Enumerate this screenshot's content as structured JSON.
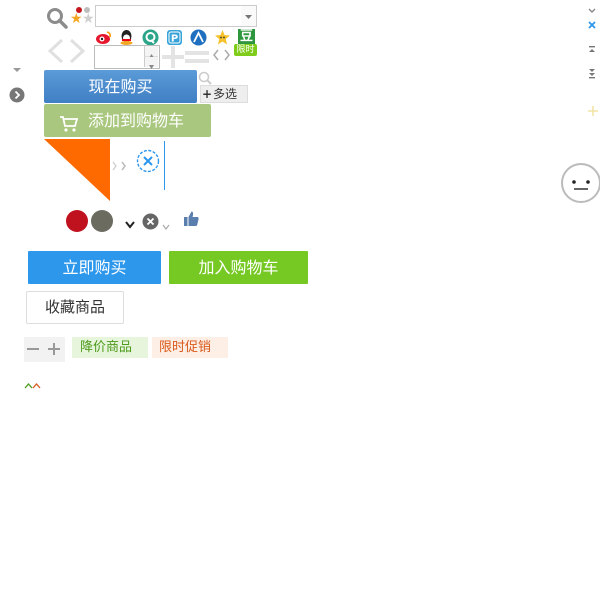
{
  "buttons": {
    "buy_now_top": "现在购买",
    "add_cart_top": "添加到购物车",
    "buy_now": "立即购买",
    "add_cart": "加入购物车",
    "favorite": "收藏商品",
    "multi_select": "多选"
  },
  "tags": {
    "price_drop": "降价商品",
    "flash_sale": "限时促销"
  },
  "badges": {
    "limited": "限时",
    "douban": "豆"
  },
  "search": {
    "value": "",
    "placeholder": ""
  },
  "stepper": {
    "value": ""
  },
  "colors": {
    "accent_blue": "#2d97ec",
    "accent_green": "#76c923",
    "orange": "#ff6a00",
    "swatch_red": "#c0111f",
    "swatch_gray": "#6b6b60"
  },
  "icons": [
    "search-icon",
    "star-icon",
    "weibo-icon",
    "qq-icon",
    "circle-q-icon",
    "p-icon",
    "person-icon",
    "sprite-icon",
    "douban-icon",
    "cart-icon",
    "close-icon",
    "thumb-up-icon",
    "smiley-face-icon"
  ]
}
